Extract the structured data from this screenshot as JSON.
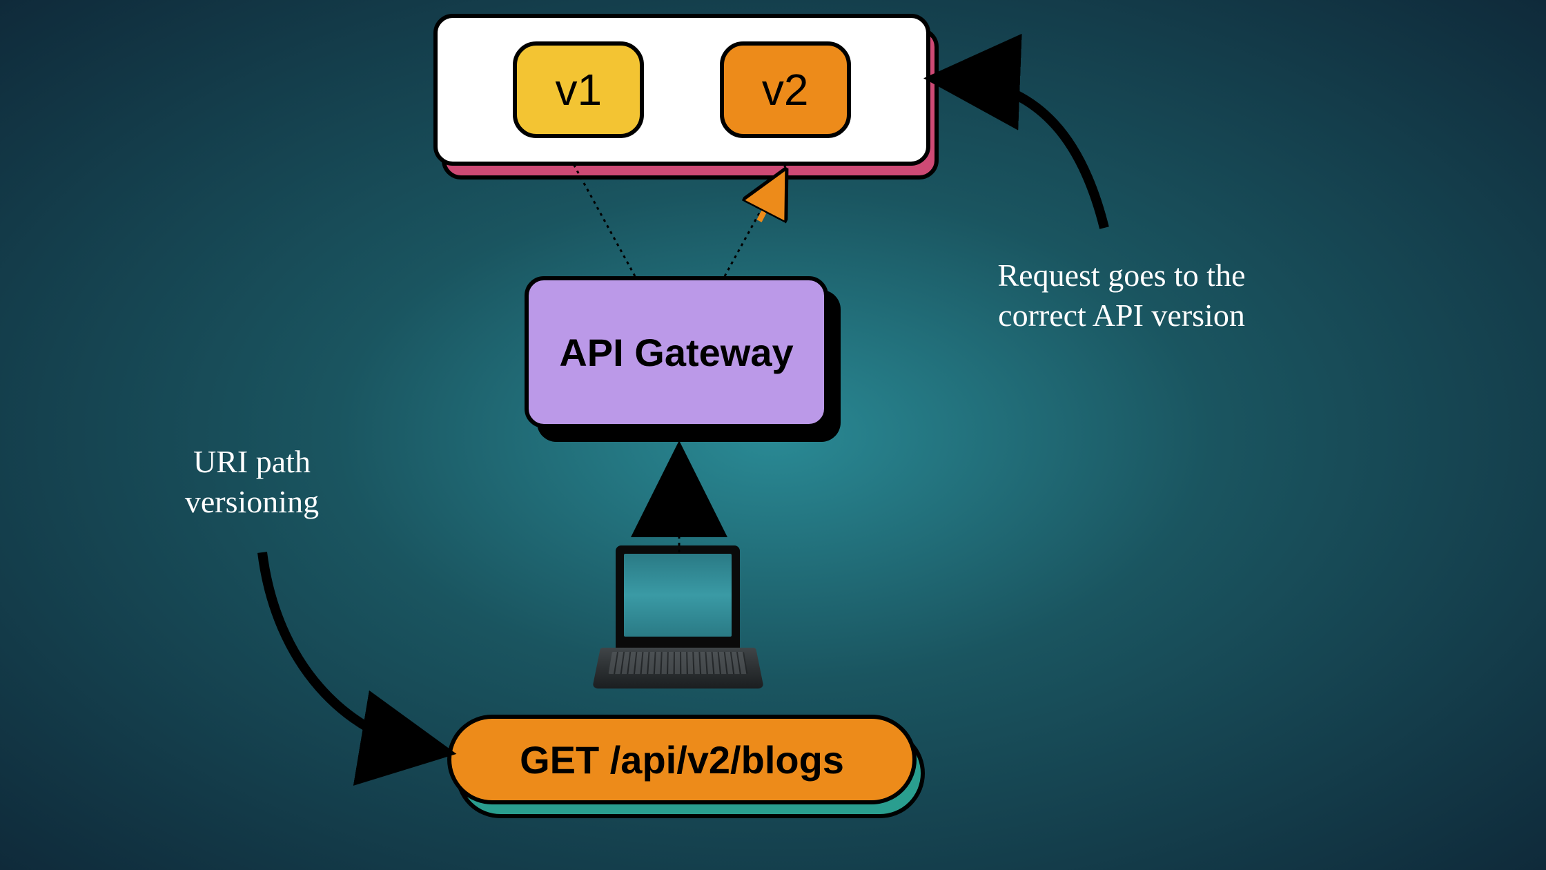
{
  "versions": {
    "v1": "v1",
    "v2": "v2"
  },
  "gateway": {
    "label": "API Gateway"
  },
  "request": {
    "label": "GET /api/v2/blogs"
  },
  "annotations": {
    "left": "URI path versioning",
    "right": "Request goes to the correct API version"
  },
  "colors": {
    "accent_yellow": "#f3c433",
    "accent_orange": "#ed8b1a",
    "gateway_purple": "#bb99e8",
    "teal": "#2a9e8f",
    "pink": "#ce4a75"
  }
}
